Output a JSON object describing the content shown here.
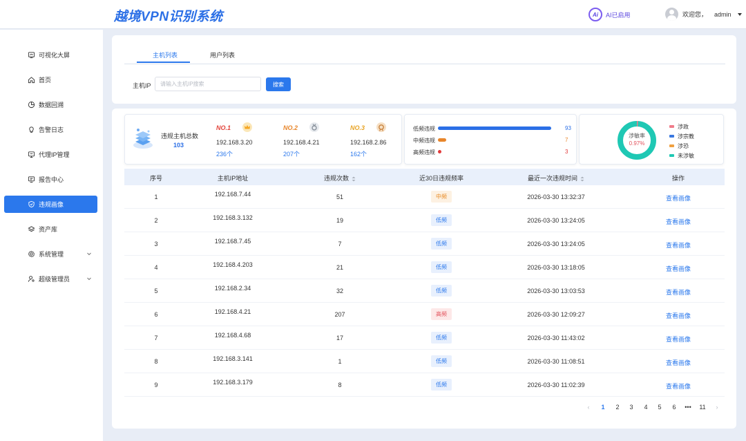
{
  "header": {
    "title": "越境VPN识别系统",
    "ai_icon_text": "Ai",
    "ai_status": "AI已启用",
    "welcome": "欢迎您，",
    "username": "admin"
  },
  "sidebar": {
    "items": [
      {
        "label": "可视化大屏",
        "icon": "monitor-icon"
      },
      {
        "label": "首页",
        "icon": "home-icon"
      },
      {
        "label": "数据回溯",
        "icon": "pie-chart-icon"
      },
      {
        "label": "告警日志",
        "icon": "bulb-icon"
      },
      {
        "label": "代理IP管理",
        "icon": "proxy-icon"
      },
      {
        "label": "报告中心",
        "icon": "report-icon"
      },
      {
        "label": "违规画像",
        "icon": "shield-icon",
        "active": true
      },
      {
        "label": "资产库",
        "icon": "layers-icon"
      },
      {
        "label": "系统管理",
        "icon": "gear-icon",
        "expandable": true
      },
      {
        "label": "超级管理员",
        "icon": "user-admin-icon",
        "expandable": true
      }
    ]
  },
  "search": {
    "tabs": [
      "主机列表",
      "用户列表"
    ],
    "active_tab": "主机列表",
    "label": "主机IP",
    "placeholder": "请输入主机IP搜索",
    "button": "搜索"
  },
  "stats": {
    "total_label": "违规主机总数",
    "total_value": "103",
    "ranks": [
      {
        "no": "NO.1",
        "ip": "192.168.3.20",
        "count": "236个",
        "color": "#e2433a",
        "medal": "#f5b63a"
      },
      {
        "no": "NO.2",
        "ip": "192.168.4.21",
        "count": "207个",
        "color": "#e8862b",
        "medal": "#9aa3ad"
      },
      {
        "no": "NO.3",
        "ip": "192.168.2.86",
        "count": "162个",
        "color": "#e8a426",
        "medal": "#d99a52"
      }
    ],
    "bars": [
      {
        "label": "低频违规",
        "value": 93,
        "color": "#2b6fe6"
      },
      {
        "label": "中频违规",
        "value": 7,
        "color": "#e8862b"
      },
      {
        "label": "高频违规",
        "value": 3,
        "color": "#e23a3a"
      }
    ],
    "donut": {
      "label": "涉敏率",
      "value": "0.97%",
      "fraction": 0.0097,
      "legend": [
        {
          "label": "涉政",
          "color": "#f07c8a"
        },
        {
          "label": "涉宗教",
          "color": "#3a78e0"
        },
        {
          "label": "涉恐",
          "color": "#f0a040"
        },
        {
          "label": "未涉敏",
          "color": "#1fc8b4"
        }
      ]
    }
  },
  "table": {
    "columns": [
      "序号",
      "主机IP地址",
      "违规次数",
      "近30日违规频率",
      "最近一次违规时间",
      "操作"
    ],
    "action_label": "查看画像",
    "rows": [
      {
        "idx": "1",
        "ip": "192.168.7.44",
        "count": "51",
        "freq": "中频",
        "level": "mid",
        "time": "2026-03-30 13:32:37"
      },
      {
        "idx": "2",
        "ip": "192.168.3.132",
        "count": "19",
        "freq": "低频",
        "level": "low",
        "time": "2026-03-30 13:24:05"
      },
      {
        "idx": "3",
        "ip": "192.168.7.45",
        "count": "7",
        "freq": "低频",
        "level": "low",
        "time": "2026-03-30 13:24:05"
      },
      {
        "idx": "4",
        "ip": "192.168.4.203",
        "count": "21",
        "freq": "低频",
        "level": "low",
        "time": "2026-03-30 13:18:05"
      },
      {
        "idx": "5",
        "ip": "192.168.2.34",
        "count": "32",
        "freq": "低频",
        "level": "low",
        "time": "2026-03-30 13:03:53"
      },
      {
        "idx": "6",
        "ip": "192.168.4.21",
        "count": "207",
        "freq": "高频",
        "level": "high",
        "time": "2026-03-30 12:09:27"
      },
      {
        "idx": "7",
        "ip": "192.168.4.68",
        "count": "17",
        "freq": "低频",
        "level": "low",
        "time": "2026-03-30 11:43:02"
      },
      {
        "idx": "8",
        "ip": "192.168.3.141",
        "count": "1",
        "freq": "低频",
        "level": "low",
        "time": "2026-03-30 11:08:51"
      },
      {
        "idx": "9",
        "ip": "192.168.3.179",
        "count": "8",
        "freq": "低频",
        "level": "low",
        "time": "2026-03-30 11:02:39"
      }
    ]
  },
  "pagination": {
    "prev": "‹",
    "pages": [
      "1",
      "2",
      "3",
      "4",
      "5",
      "6",
      "•••",
      "11"
    ],
    "active": "1",
    "next": "›"
  }
}
